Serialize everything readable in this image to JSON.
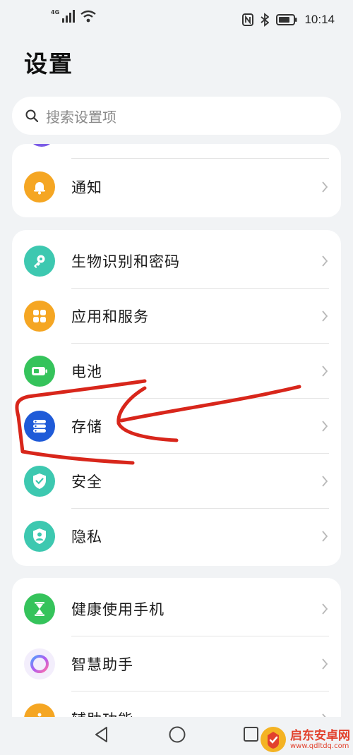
{
  "status_bar": {
    "network_type": "4G",
    "time": "10:14"
  },
  "page_title": "设置",
  "search": {
    "placeholder": "搜索设置项"
  },
  "groups": [
    {
      "items": [
        {
          "label": "通知",
          "icon": "bell-icon",
          "color": "#f5a623"
        }
      ]
    },
    {
      "items": [
        {
          "label": "生物识别和密码",
          "icon": "key-icon",
          "color": "#3dc8b0"
        },
        {
          "label": "应用和服务",
          "icon": "apps-grid-icon",
          "color": "#f5a623"
        },
        {
          "label": "电池",
          "icon": "battery-icon",
          "color": "#35c35b"
        },
        {
          "label": "存储",
          "icon": "storage-icon",
          "color": "#1f5bd8"
        },
        {
          "label": "安全",
          "icon": "shield-check-icon",
          "color": "#3dc8b0"
        },
        {
          "label": "隐私",
          "icon": "privacy-icon",
          "color": "#3dc8b0"
        }
      ]
    },
    {
      "items": [
        {
          "label": "健康使用手机",
          "icon": "hourglass-icon",
          "color": "#35c35b"
        },
        {
          "label": "智慧助手",
          "icon": "assistant-ring-icon",
          "color": "#a46cf0"
        },
        {
          "label": "辅助功能",
          "icon": "accessibility-icon",
          "color": "#f5a623"
        }
      ]
    }
  ],
  "watermark": {
    "name": "启东安卓网",
    "url": "www.qdltdq.com"
  },
  "colors": {
    "background": "#f1f3f5",
    "card": "#ffffff",
    "annotation_red": "#d8261b"
  }
}
